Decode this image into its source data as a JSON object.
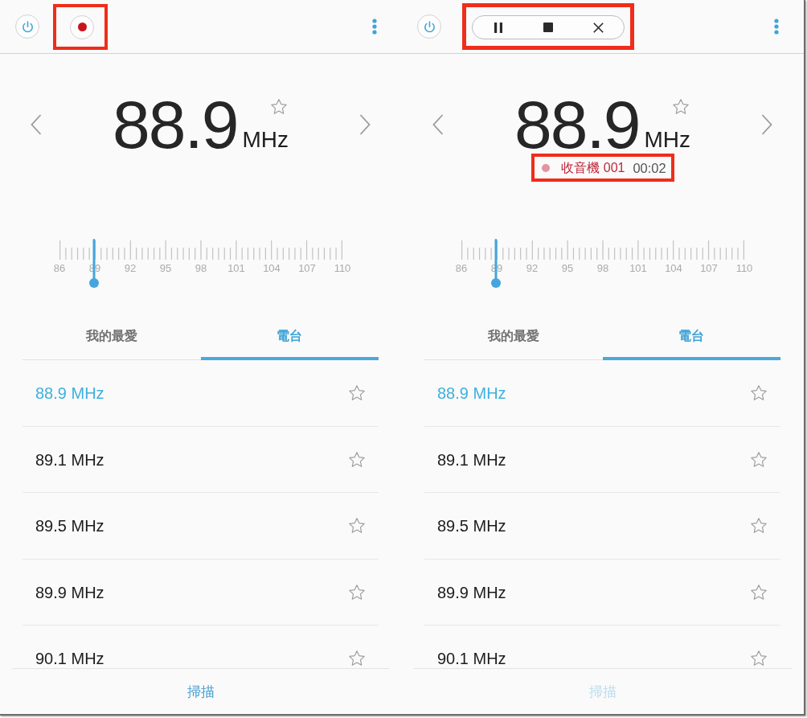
{
  "screens": [
    {
      "top_bar": {
        "record_control": {
          "kind": "record",
          "highlighted": true
        }
      },
      "frequency": {
        "value": "88.9",
        "unit": "MHz",
        "favorite": false
      },
      "tuner": {
        "level": 0.121,
        "scale_labels": [
          "86",
          "89",
          "92",
          "95",
          "98",
          "101",
          "104",
          "107",
          "110"
        ]
      },
      "tabs": [
        {
          "label": "我的最愛",
          "selected": false
        },
        {
          "label": "電台",
          "selected": true
        }
      ],
      "stations": [
        {
          "label": "88.9 MHz",
          "selected": true,
          "favorite": false
        },
        {
          "label": "89.1 MHz",
          "selected": false,
          "favorite": false
        },
        {
          "label": "89.5 MHz",
          "selected": false,
          "favorite": false
        },
        {
          "label": "89.9 MHz",
          "selected": false,
          "favorite": false
        },
        {
          "label": "90.1 MHz",
          "selected": false,
          "favorite": false
        }
      ],
      "scan_button": {
        "label": "掃描",
        "disabled": false
      }
    },
    {
      "top_bar": {
        "record_control": {
          "kind": "recording",
          "highlighted": true
        }
      },
      "frequency": {
        "value": "88.9",
        "unit": "MHz",
        "favorite": false
      },
      "recording": {
        "name": "收音機 001",
        "time": "00:02",
        "highlighted": true
      },
      "tuner": {
        "level": 0.121,
        "scale_labels": [
          "86",
          "89",
          "92",
          "95",
          "98",
          "101",
          "104",
          "107",
          "110"
        ]
      },
      "tabs": [
        {
          "label": "我的最愛",
          "selected": false
        },
        {
          "label": "電台",
          "selected": true
        }
      ],
      "stations": [
        {
          "label": "88.9 MHz",
          "selected": true,
          "favorite": false
        },
        {
          "label": "89.1 MHz",
          "selected": false,
          "favorite": false
        },
        {
          "label": "89.5 MHz",
          "selected": false,
          "favorite": false
        },
        {
          "label": "89.9 MHz",
          "selected": false,
          "favorite": false
        },
        {
          "label": "90.1 MHz",
          "selected": false,
          "favorite": false
        }
      ],
      "scan_button": {
        "label": "掃描",
        "disabled": true
      }
    }
  ]
}
